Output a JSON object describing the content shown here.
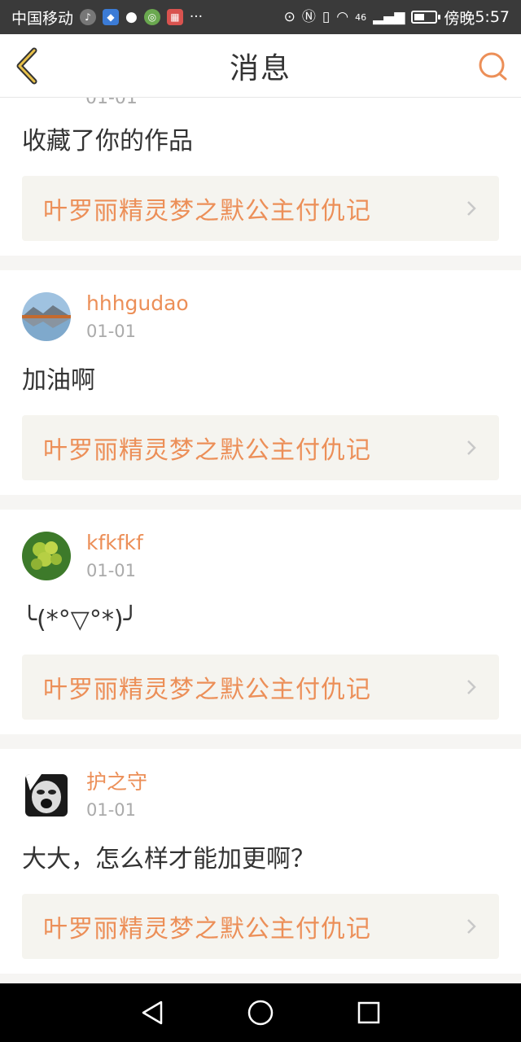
{
  "status_bar": {
    "carrier": "中国移动",
    "network": "46",
    "time_prefix": "傍晚",
    "time": "5:57",
    "battery_level": 0.5
  },
  "header": {
    "title": "消息",
    "back_icon": "chevron-left-icon",
    "search_icon": "search-icon"
  },
  "notifications": [
    {
      "username": "",
      "date": "01-01",
      "message": "收藏了你的作品",
      "work_title": "叶罗丽精灵梦之默公主付仇记"
    },
    {
      "username": "hhhgudao",
      "date": "01-01",
      "message": "加油啊",
      "work_title": "叶罗丽精灵梦之默公主付仇记"
    },
    {
      "username": "kfkfkf",
      "date": "01-01",
      "message": "╰(*°▽°*)╯",
      "work_title": "叶罗丽精灵梦之默公主付仇记"
    },
    {
      "username": "护之守",
      "date": "01-01",
      "message": "大大，怎么样才能加更啊？",
      "work_title": "叶罗丽精灵梦之默公主付仇记"
    }
  ],
  "colors": {
    "accent": "#ec8f58",
    "link_bg": "#f5f4ef",
    "status_bg": "#3a3a3a",
    "nav_bg": "#000000"
  }
}
